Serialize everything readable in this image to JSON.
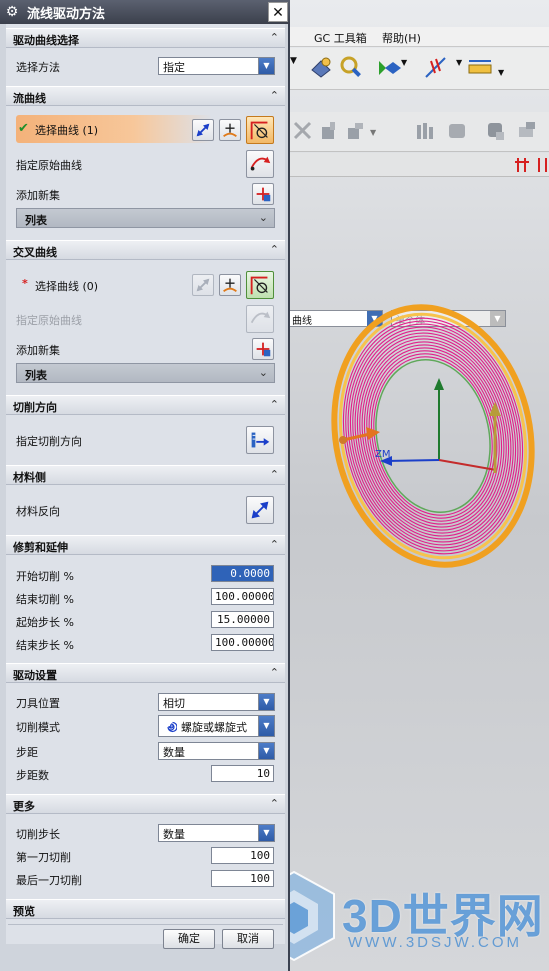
{
  "dialog": {
    "title": "流线驱动方法",
    "ok_label": "确定",
    "cancel_label": "取消",
    "accent_color": "#2f63b8"
  },
  "sections": {
    "drive_curve": {
      "title": "驱动曲线选择",
      "method_label": "选择方法",
      "method_value": "指定"
    },
    "flow_curve": {
      "title": "流曲线",
      "select_label": "选择曲线 (1)",
      "original_label": "指定原始曲线",
      "add_set_label": "添加新集",
      "list_label": "列表"
    },
    "cross_curve": {
      "title": "交叉曲线",
      "required_mark": "*",
      "select_label": "选择曲线 (0)",
      "original_label": "指定原始曲线",
      "add_set_label": "添加新集",
      "list_label": "列表"
    },
    "cut_direction": {
      "title": "切削方向",
      "specify_label": "指定切削方向"
    },
    "material_side": {
      "title": "材料侧",
      "reverse_label": "材料反向"
    },
    "trim_extend": {
      "title": "修剪和延伸",
      "fields": [
        {
          "label": "开始切削 %",
          "value": "0.0000"
        },
        {
          "label": "结束切削 %",
          "value": "100.00000"
        },
        {
          "label": "起始步长 %",
          "value": "15.00000"
        },
        {
          "label": "结束步长 %",
          "value": "100.00000"
        }
      ]
    },
    "drive_settings": {
      "title": "驱动设置",
      "tool_position_label": "刀具位置",
      "tool_position_value": "相切",
      "cut_pattern_label": "切削模式",
      "cut_pattern_value": "螺旋或螺旋式",
      "stepover_label": "步距",
      "stepover_value": "数量",
      "stepover_count_label": "步距数",
      "stepover_count_value": "10"
    },
    "more": {
      "title": "更多",
      "cut_step_label": "切削步长",
      "cut_step_value": "数量",
      "first_cut_label": "第一刀切削",
      "first_cut_value": "100",
      "last_cut_label": "最后一刀切削",
      "last_cut_value": "100"
    },
    "preview": {
      "title": "预览"
    }
  },
  "background": {
    "menus": [
      "GC 工具箱",
      "帮助(H)"
    ],
    "filter_combo": "曲线",
    "filter_combo2": "单个体",
    "csys_label": "ZM",
    "watermark_text": "3D世界网",
    "watermark_url": "WWW.3DSJW.COM",
    "toolpath_color": "#e0208a",
    "part_color": "#f0a020"
  }
}
